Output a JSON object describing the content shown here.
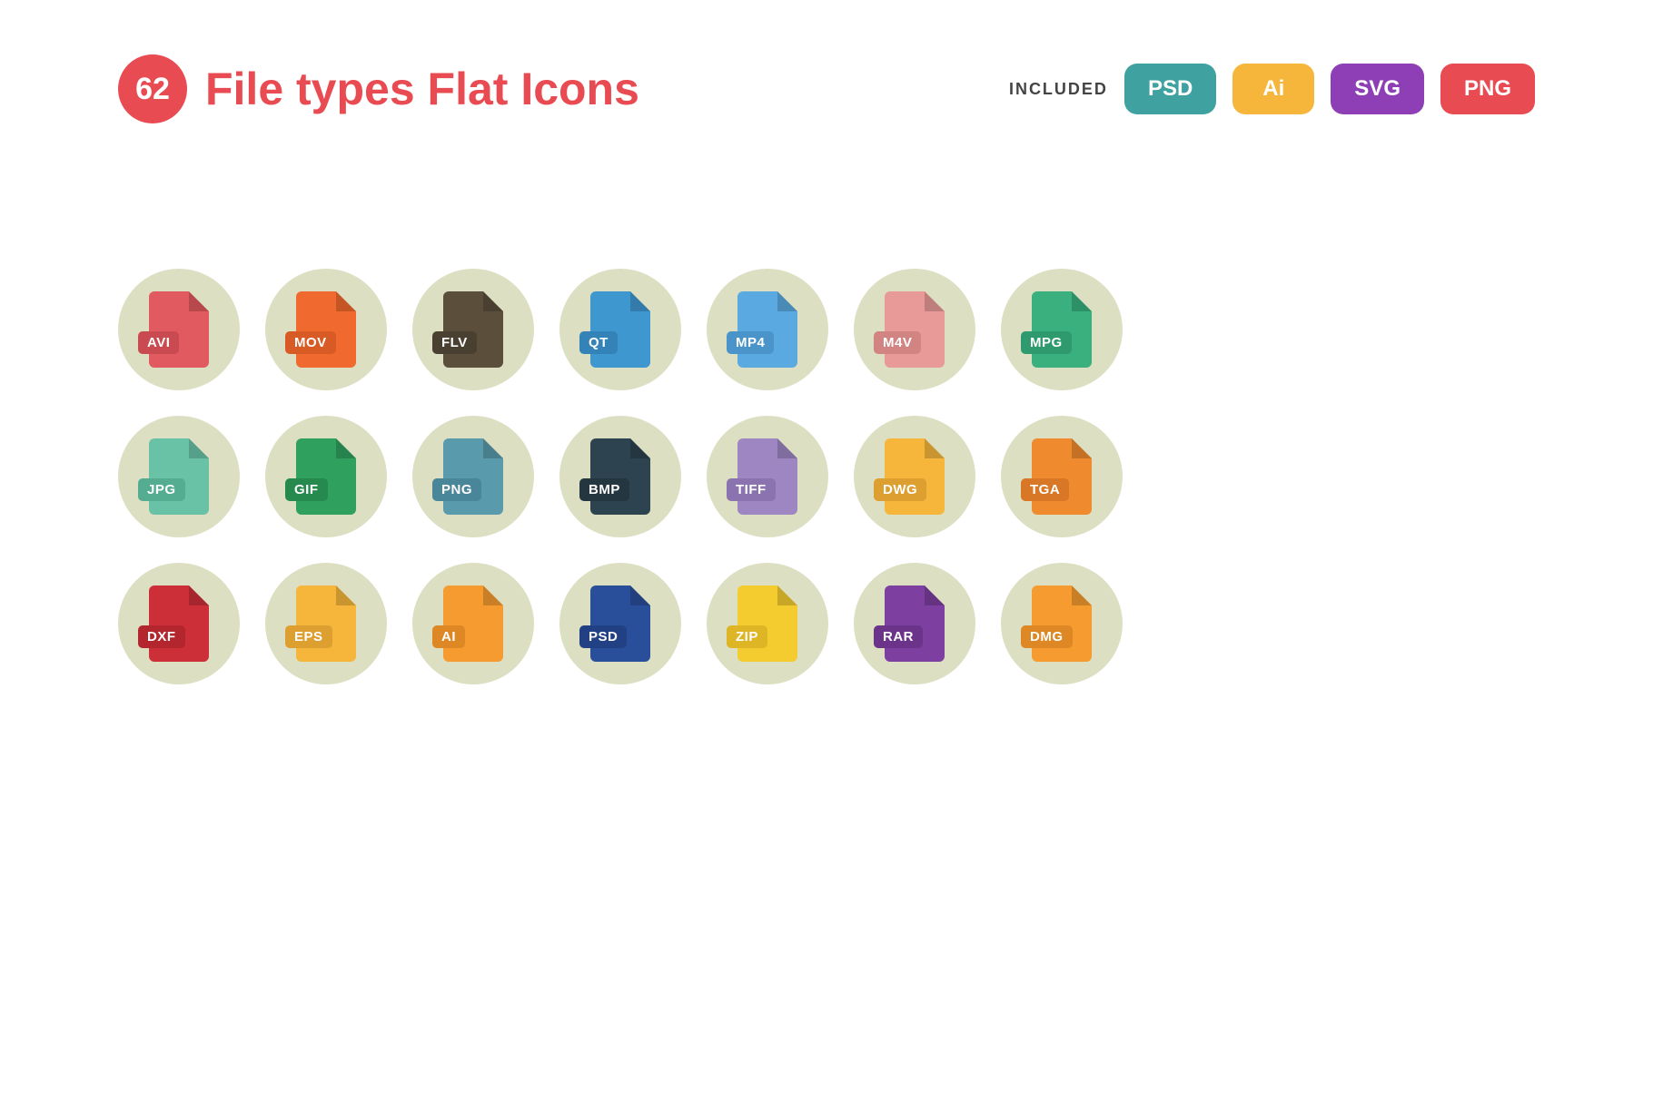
{
  "header": {
    "count": "62",
    "title": "File types Flat Icons",
    "included_label": "INCLUDED",
    "formats": [
      {
        "label": "PSD",
        "color": "#3fa2a0"
      },
      {
        "label": "Ai",
        "color": "#f5b63b"
      },
      {
        "label": "SVG",
        "color": "#8f3fb5"
      },
      {
        "label": "PNG",
        "color": "#e94b52"
      }
    ]
  },
  "icons": [
    {
      "label": "AVI",
      "file": "#e05a5f",
      "tag": "#c94a50"
    },
    {
      "label": "MOV",
      "file": "#f06a2f",
      "tag": "#d85a25"
    },
    {
      "label": "FLV",
      "file": "#5b4f3c",
      "tag": "#4a4031"
    },
    {
      "label": "QT",
      "file": "#3f97d0",
      "tag": "#3382b8"
    },
    {
      "label": "MP4",
      "file": "#5aa9e0",
      "tag": "#4a94c9"
    },
    {
      "label": "M4V",
      "file": "#e89a98",
      "tag": "#d18481"
    },
    {
      "label": "MPG",
      "file": "#39b07e",
      "tag": "#2f9a6d"
    },
    {
      "label": "JPG",
      "file": "#6ac2a6",
      "tag": "#55ad91"
    },
    {
      "label": "GIF",
      "file": "#2fa05e",
      "tag": "#268a4f"
    },
    {
      "label": "PNG",
      "file": "#5a9aad",
      "tag": "#4a8699"
    },
    {
      "label": "BMP",
      "file": "#2d4450",
      "tag": "#24363f"
    },
    {
      "label": "TIFF",
      "file": "#9d86c2",
      "tag": "#8a73af"
    },
    {
      "label": "DWG",
      "file": "#f5b63b",
      "tag": "#dda030"
    },
    {
      "label": "TGA",
      "file": "#f08a2f",
      "tag": "#d87725"
    },
    {
      "label": "DXF",
      "file": "#cc2f38",
      "tag": "#b3262e"
    },
    {
      "label": "EPS",
      "file": "#f5b63b",
      "tag": "#dda030"
    },
    {
      "label": "AI",
      "file": "#f59b2f",
      "tag": "#dd8825"
    },
    {
      "label": "PSD",
      "file": "#2a4f9a",
      "tag": "#224185"
    },
    {
      "label": "ZIP",
      "file": "#f5cc2f",
      "tag": "#ddb525"
    },
    {
      "label": "RAR",
      "file": "#7d3fa0",
      "tag": "#6b338a"
    },
    {
      "label": "DMG",
      "file": "#f59b2f",
      "tag": "#dd8825"
    }
  ]
}
